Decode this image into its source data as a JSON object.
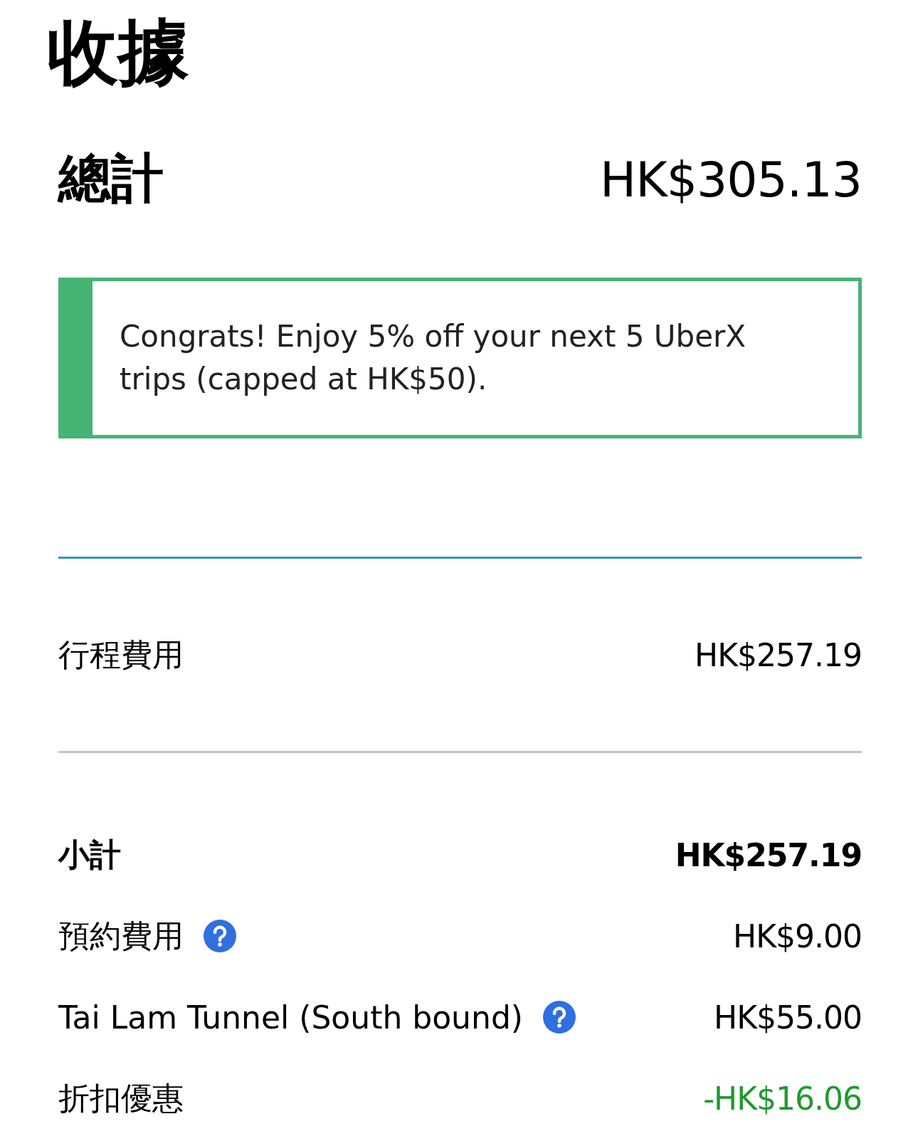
{
  "title": "收據",
  "total": {
    "label": "總計",
    "amount": "HK$305.13"
  },
  "promo": {
    "text": "Congrats! Enjoy 5% off your next 5 UberX trips (capped at HK$50)."
  },
  "trip_fare": {
    "label": "行程費用",
    "amount": "HK$257.19"
  },
  "items": [
    {
      "kind": "subtotal",
      "label": "小計",
      "amount": "HK$257.19",
      "help": false
    },
    {
      "kind": "fee",
      "label": "預約費用",
      "amount": "HK$9.00",
      "help": true
    },
    {
      "kind": "fee",
      "label": "Tai Lam Tunnel (South bound)",
      "amount": "HK$55.00",
      "help": true
    },
    {
      "kind": "discount",
      "label": "折扣優惠",
      "amount": "-HK$16.06",
      "help": false
    }
  ]
}
